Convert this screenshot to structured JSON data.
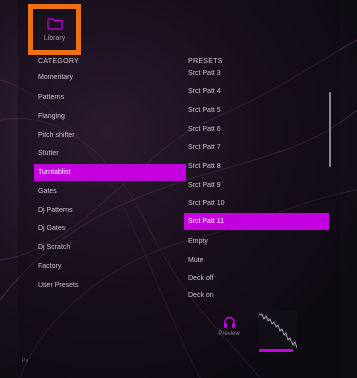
{
  "library": {
    "label": "Library",
    "icon": "folder-icon"
  },
  "category": {
    "heading": "CATEGORY",
    "items": [
      "Momentary",
      "Patterns",
      "Flanging",
      "Pitch shifter",
      "Stutter",
      "Turntablist",
      "Gates",
      "Dj Patterns",
      "Dj Gates",
      "Dj Scratch",
      "Factory",
      "User Presets"
    ],
    "selected": "Turntablist"
  },
  "presets": {
    "heading": "PRESETS",
    "items": [
      "Srct Patt 3",
      "Srct Patt 4",
      "Srct Patt 5",
      "Srct Patt 6",
      "Srct Patt 7",
      "Srct Patt 8",
      "Srct Patt 9",
      "Srct Patt 10",
      "Srct Patt 11",
      "Empty",
      "Mute",
      "Deck off",
      "Deck on"
    ],
    "selected": "Srct Patt 11"
  },
  "preview": {
    "label": "Preview",
    "icon": "headphones-icon"
  },
  "corner_mark": "Pa",
  "colors": {
    "accent": "#c400e0",
    "highlight_frame": "#f06f10",
    "background": "#0d0a10"
  }
}
